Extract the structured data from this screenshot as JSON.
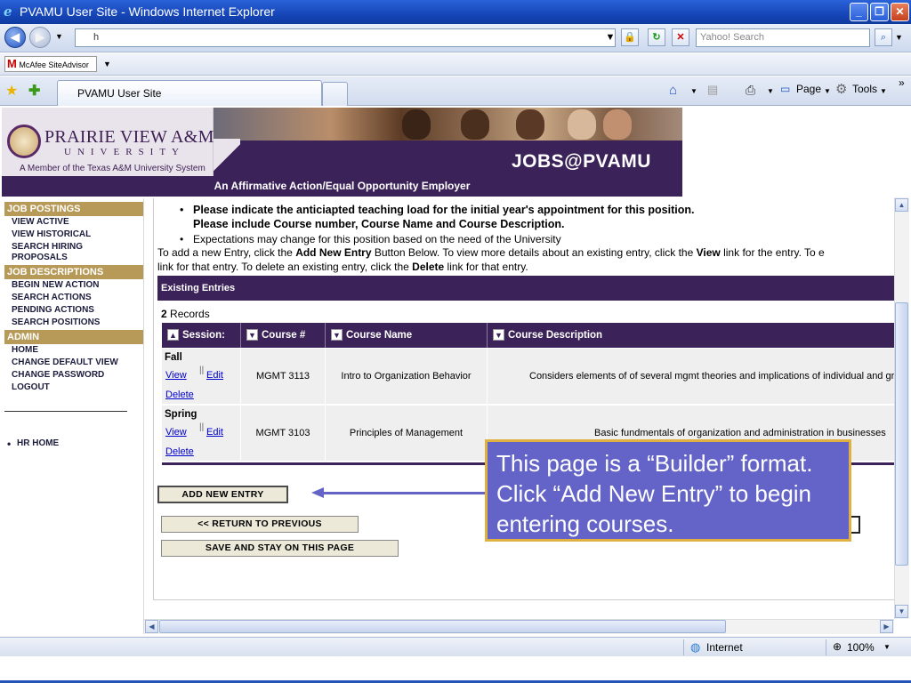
{
  "window": {
    "title": "PVAMU User Site - Windows Internet Explorer",
    "minimize": "_",
    "maximize": "❐",
    "close": "✕"
  },
  "browser": {
    "address": "h",
    "search_placeholder": "Yahoo! Search",
    "mcafee_label": "McAfee SiteAdvisor",
    "tab_label": "PVAMU User Site",
    "page_menu": "Page",
    "tools_menu": "Tools",
    "status_zone": "Internet",
    "zoom": "100%"
  },
  "banner": {
    "university_name": "PRAIRIE VIEW A&M",
    "university_word": "UNIVERSITY",
    "member_text": "A Member of the Texas A&M University System",
    "site_name": "JOBS@PVAMU",
    "eoe_text": "An Affirmative Action/Equal Opportunity Employer"
  },
  "sidebar": {
    "sections": [
      {
        "heading": "JOB POSTINGS",
        "items": [
          "VIEW ACTIVE",
          "VIEW HISTORICAL",
          "SEARCH HIRING PROPOSALS"
        ]
      },
      {
        "heading": "JOB DESCRIPTIONS",
        "items": [
          "BEGIN NEW ACTION",
          "SEARCH ACTIONS",
          "PENDING ACTIONS",
          "SEARCH POSITIONS"
        ]
      },
      {
        "heading": "ADMIN",
        "items": [
          "HOME",
          "CHANGE DEFAULT VIEW",
          "CHANGE PASSWORD",
          "LOGOUT"
        ]
      }
    ],
    "hr_home": "HR HOME"
  },
  "instructions": {
    "bullet1_line1": "Please indicate the anticiapted teaching load for the initial year's appointment for this position.",
    "bullet1_line2": "Please include Course number, Course Name and Course Description.",
    "bullet2": "Expectations may change for this position based on the need of the University",
    "para_1": "To add a new Entry, click the ",
    "para_bold1": "Add New Entry",
    "para_2": " Button Below. To view more details about an existing entry, click the ",
    "para_bold2": "View",
    "para_3": " link for the entry. To e",
    "para_line2a": "link for that entry. To delete an existing entry, click the ",
    "para_bold3": "Delete",
    "para_line2b": " link for that entry."
  },
  "entries": {
    "header": "Existing Entries",
    "record_count": "2",
    "record_label": "Records",
    "columns": [
      "Session:",
      "Course #",
      "Course Name",
      "Course Description"
    ],
    "rows": [
      {
        "session": "Fall",
        "course_num": "MGMT 3113",
        "course_name": "Intro to Organization Behavior",
        "description": "Considers elements of of several mgmt theories and implications of individual and grou"
      },
      {
        "session": "Spring",
        "course_num": "MGMT 3103",
        "course_name": "Principles of Management",
        "description": "Basic fundmentals of organization and administration in businesses"
      }
    ],
    "link_view": "View",
    "link_edit": "Edit",
    "link_delete": "Delete"
  },
  "buttons": {
    "add_new_entry": "ADD NEW ENTRY",
    "return_previous": "<< RETURN TO PREVIOUS",
    "save_stay": "SAVE AND STAY ON THIS PAGE"
  },
  "callout": {
    "line1": "This page is a “Builder” format.",
    "line2": "Click “Add New Entry” to begin",
    "line3": "entering courses."
  },
  "colors": {
    "purple": "#3b2258",
    "gold": "#b89a58",
    "callout": "#6464c8"
  }
}
